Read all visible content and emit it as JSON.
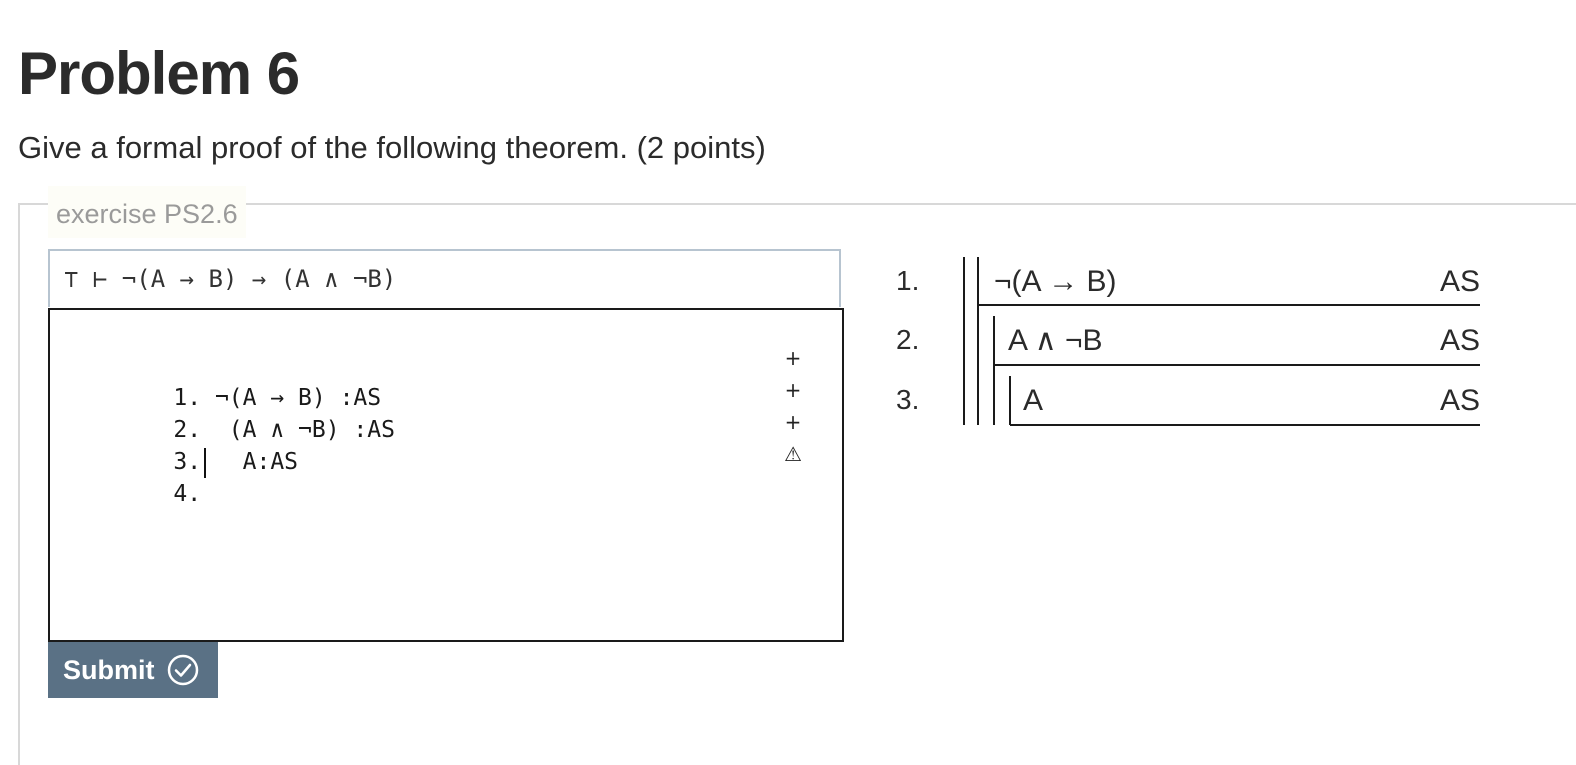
{
  "page": {
    "title": "Problem 6",
    "description": "Give a formal proof of the following theorem. (2 points)"
  },
  "exercise": {
    "legend": "exercise PS2.6",
    "goal": "⊤ ⊢ ¬(A → B) → (A ∧ ¬B)",
    "editor_lines": [
      {
        "num": "1.",
        "text": " ¬(A → B) :AS"
      },
      {
        "num": "2.",
        "text": "  (A ∧ ¬B) :AS"
      },
      {
        "num": "3.",
        "text": "   A:AS"
      },
      {
        "num": "4.",
        "text": ""
      }
    ],
    "gutter_marks": [
      "+",
      "+",
      "+",
      "⚠"
    ],
    "submit_label": "Submit"
  },
  "rendered_proof": [
    {
      "num": "1.",
      "formula": "¬(A → B)",
      "justification": "AS"
    },
    {
      "num": "2.",
      "formula": "A ∧ ¬B",
      "justification": "AS"
    },
    {
      "num": "3.",
      "formula": "A",
      "justification": "AS"
    }
  ],
  "colors": {
    "submit_bg": "#5a7185",
    "goal_border": "#b7c4d0",
    "legend_text": "#9a9a9a"
  }
}
